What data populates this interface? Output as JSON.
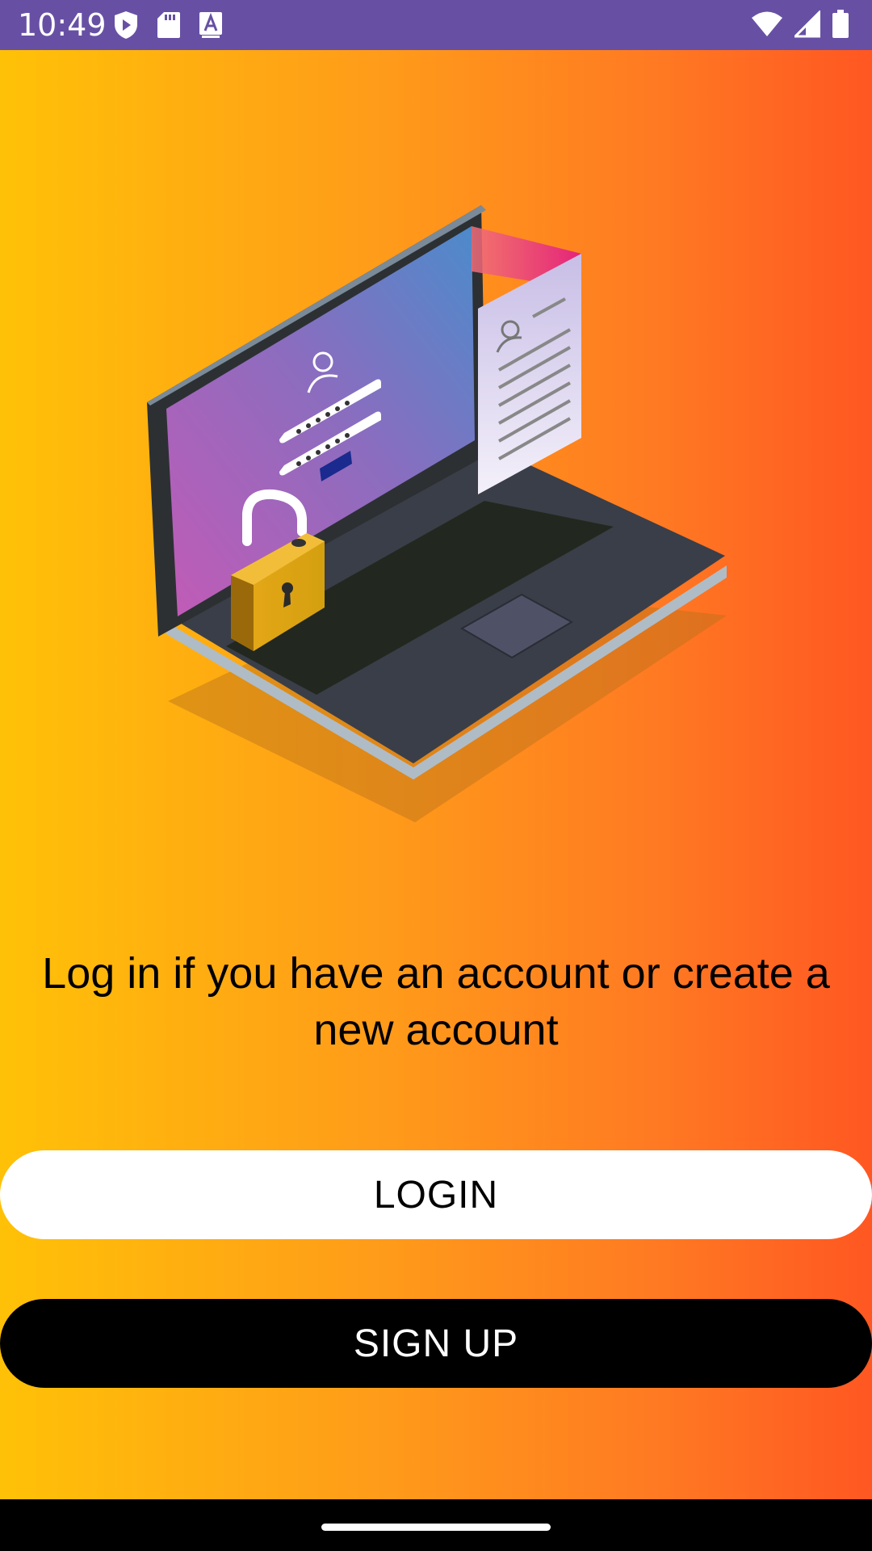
{
  "status_bar": {
    "time": "10:49",
    "left_icons": [
      "shield-play-icon",
      "sd-card-icon",
      "keyboard-a-icon"
    ],
    "right_icons": [
      "wifi-icon",
      "signal-icon",
      "battery-icon"
    ],
    "background": "#6750A4"
  },
  "illustration": {
    "description_icon": "laptop-login-security-illustration"
  },
  "main": {
    "message": "Log in if you have an account or create a new account"
  },
  "buttons": {
    "login_label": "LOGIN",
    "signup_label": "SIGN UP"
  },
  "colors": {
    "gradient_start": "#FFC107",
    "gradient_end": "#FF5722",
    "login_bg": "#FFFFFF",
    "signup_bg": "#000000"
  }
}
